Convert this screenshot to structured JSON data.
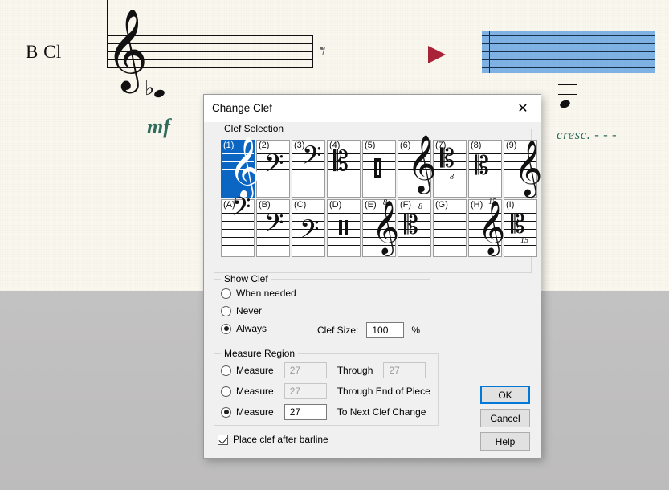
{
  "score": {
    "instrument_label": "B Cl",
    "dynamic": "mf",
    "cresc": "cresc. - - -",
    "rest_glyph": "⹏"
  },
  "dialog": {
    "title": "Change Clef",
    "close_icon": "✕",
    "clef_selection": {
      "legend": "Clef Selection",
      "row1": [
        {
          "id": "(1)",
          "glyph": "𝄞",
          "name": "treble-clef",
          "selected": true
        },
        {
          "id": "(2)",
          "glyph": "𝄢",
          "name": "alto-clef",
          "selected": false
        },
        {
          "id": "(3)",
          "glyph": "𝄢",
          "name": "tenor-clef",
          "selected": false
        },
        {
          "id": "(4)",
          "glyph": "𝄢",
          "name": "bass-clef",
          "selected": false
        },
        {
          "id": "(5)",
          "glyph": "",
          "name": "percussion-clef",
          "selected": false
        },
        {
          "id": "(6)",
          "glyph": "𝄞",
          "name": "treble-clef-high",
          "selected": false
        },
        {
          "id": "(7)",
          "glyph": "𝄢",
          "name": "bass-clef-octave-down",
          "octave": "8",
          "selected": false
        },
        {
          "id": "(8)",
          "glyph": "𝄢",
          "name": "bass-clef-alt",
          "selected": false
        },
        {
          "id": "(9)",
          "glyph": "𝄞",
          "name": "treble-clef-alt",
          "selected": false
        }
      ],
      "row2": [
        {
          "id": "(A)",
          "glyph": "𝄢",
          "name": "alto-clef-high",
          "selected": false
        },
        {
          "id": "(B)",
          "glyph": "𝄢",
          "name": "alto-clef-mid",
          "selected": false
        },
        {
          "id": "(C)",
          "glyph": "𝄢",
          "name": "baritone-clef",
          "selected": false
        },
        {
          "id": "(D)",
          "glyph": "",
          "name": "percussion-clef-2",
          "selected": false
        },
        {
          "id": "(E)",
          "glyph": "𝄞",
          "name": "treble-clef-8va",
          "octave": "8",
          "selected": false
        },
        {
          "id": "(F)",
          "glyph": "𝄢",
          "name": "bass-clef-8va",
          "octave": "8",
          "selected": false
        },
        {
          "id": "(G)",
          "glyph": "",
          "name": "blank-clef",
          "selected": false
        },
        {
          "id": "(H)",
          "glyph": "𝄞",
          "name": "treble-clef-15ma",
          "octave": "15",
          "selected": false
        },
        {
          "id": "(I)",
          "glyph": "𝄢",
          "name": "bass-clef-15mb",
          "octave": "15",
          "selected": false
        }
      ]
    },
    "show_clef": {
      "legend": "Show Clef",
      "options": [
        {
          "label": "When needed",
          "selected": false
        },
        {
          "label": "Never",
          "selected": false
        },
        {
          "label": "Always",
          "selected": true
        }
      ],
      "clef_size_label": "Clef Size:",
      "clef_size_value": "100",
      "percent": "%"
    },
    "measure_region": {
      "legend": "Measure Region",
      "rows": [
        {
          "label": "Measure",
          "value": "27",
          "mid": "Through",
          "value2": "27",
          "selected": false,
          "enabled": false
        },
        {
          "label": "Measure",
          "value": "27",
          "mid": "Through End of Piece",
          "selected": false,
          "enabled": false
        },
        {
          "label": "Measure",
          "value": "27",
          "mid": "To Next Clef Change",
          "selected": true,
          "enabled": true
        }
      ]
    },
    "place_clef_after_barline": {
      "label": "Place clef after barline",
      "checked": true
    },
    "buttons": {
      "ok": "OK",
      "cancel": "Cancel",
      "help": "Help"
    }
  },
  "colors": {
    "accent": "#0078d7",
    "selection_blue": "#0b66c3",
    "staff_highlight": "#7fb2e5",
    "dynamic_green": "#2f6d5d",
    "arrow_red": "#ab2338",
    "page_cream": "#faf8ee",
    "desk_gray": "#c0bfbf"
  }
}
